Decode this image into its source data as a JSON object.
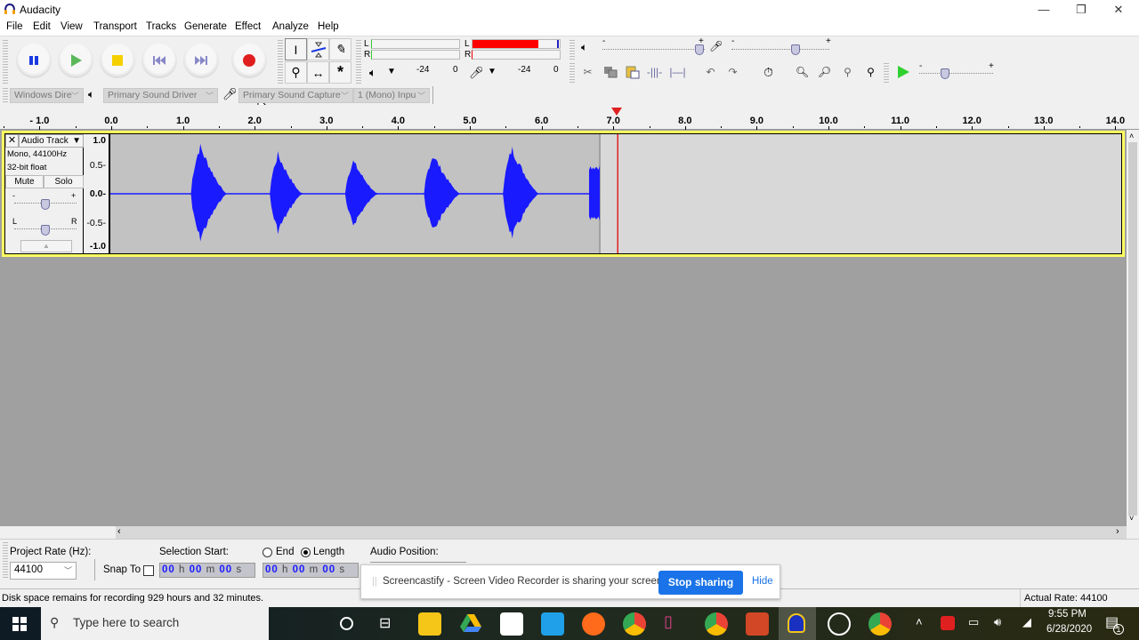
{
  "window": {
    "title": "Audacity",
    "controls": {
      "minimize": "—",
      "maximize": "❐",
      "close": "✕"
    }
  },
  "menu": [
    "File",
    "Edit",
    "View",
    "Transport",
    "Tracks",
    "Generate",
    "Effect",
    "Analyze",
    "Help"
  ],
  "transport": {
    "buttons": [
      "pause",
      "play",
      "stop",
      "skip-to-start",
      "skip-to-end",
      "record"
    ]
  },
  "tools": [
    "selection-tool",
    "envelope-tool",
    "draw-tool",
    "zoom-tool",
    "time-shift-tool",
    "multi-tool"
  ],
  "meters": {
    "playback": {
      "channels": [
        "L",
        "R"
      ],
      "scale": [
        "-24",
        "0"
      ],
      "level": 0
    },
    "recording": {
      "channels": [
        "L",
        "R"
      ],
      "scale": [
        "-24",
        "0"
      ],
      "level_L": 0.75,
      "peak_L": 0.97
    }
  },
  "mixer": {
    "playback_volume": {
      "minus": "-",
      "plus": "+",
      "level": 0.95
    },
    "record_volume": {
      "minus": "-",
      "plus": "+",
      "level": 0.65
    }
  },
  "edit_toolbar": [
    "cut",
    "copy",
    "paste",
    "trim",
    "silence",
    "undo",
    "redo",
    "sync-lock",
    "zoom-in",
    "zoom-out",
    "fit-selection",
    "fit-project"
  ],
  "play_at_speed": {
    "minus": "-",
    "plus": "+",
    "level": 0.35
  },
  "devices": {
    "host": "Windows Dire",
    "playback_device": "Primary Sound Driver",
    "recording_device": "Primary Sound Capture",
    "channels": "1 (Mono) Inpu"
  },
  "ruler": {
    "labels": [
      "- 1.0",
      "0.0",
      "1.0",
      "2.0",
      "3.0",
      "4.0",
      "5.0",
      "6.0",
      "7.0",
      "8.0",
      "9.0",
      "10.0",
      "11.0",
      "12.0",
      "13.0",
      "14.0"
    ],
    "playhead_seconds": 7.05
  },
  "track": {
    "name": "Audio Track",
    "format": "Mono, 44100Hz",
    "bit_depth": "32-bit float",
    "mute_label": "Mute",
    "solo_label": "Solo",
    "gain": {
      "minus": "-",
      "plus": "+",
      "level": 0.5
    },
    "pan": {
      "left": "L",
      "right": "R",
      "level": 0.5
    },
    "scale": [
      "1.0",
      "0.5-",
      "0.0-",
      "-0.5-",
      "-1.0"
    ],
    "clip_end_seconds": 6.8,
    "bursts": [
      {
        "start": 1.1,
        "end": 1.6,
        "peak": 0.95
      },
      {
        "start": 2.2,
        "end": 2.65,
        "peak": 0.78
      },
      {
        "start": 3.25,
        "end": 3.7,
        "peak": 0.65
      },
      {
        "start": 4.35,
        "end": 4.85,
        "peak": 0.78
      },
      {
        "start": 5.45,
        "end": 5.95,
        "peak": 0.9
      },
      {
        "start": 6.65,
        "end": 6.8,
        "peak": 0.6
      }
    ]
  },
  "selection_toolbar": {
    "project_rate_label": "Project Rate (Hz):",
    "project_rate_value": "44100",
    "snap_to_label": "Snap To",
    "selection_start_label": "Selection Start:",
    "end_label": "End",
    "length_label": "Length",
    "length_selected": true,
    "start_time": {
      "h": "00",
      "m": "00",
      "s": "00"
    },
    "length_time": {
      "h": "00",
      "m": "00",
      "s": "00"
    },
    "audio_position_label": "Audio Position:",
    "units": {
      "h": "h",
      "m": "m",
      "s": "s"
    }
  },
  "status": {
    "message": "Disk space remains for recording 929 hours and 32 minutes.",
    "actual_rate": "Actual Rate: 44100"
  },
  "share_notification": {
    "text": "Screencastify - Screen Video Recorder is sharing your screen.",
    "stop_label": "Stop sharing",
    "hide_label": "Hide"
  },
  "taskbar": {
    "search_placeholder": "Type here to search",
    "apps": [
      "cortana",
      "task-view",
      "file-explorer",
      "google-drive",
      "app-grid",
      "mail",
      "firefox",
      "chrome",
      "phone-link",
      "chrome-profile-f",
      "powerpoint",
      "audacity",
      "photo-app",
      "chrome-profile-user"
    ],
    "time": "9:55 PM",
    "date": "6/28/2020",
    "notification_count": "1"
  },
  "colors": {
    "waveform": "#1a1aff",
    "track_highlight": "#ffff60",
    "playhead": "#e02020",
    "record_meter": "#ff0000",
    "stop_share_button": "#1a73e8"
  }
}
